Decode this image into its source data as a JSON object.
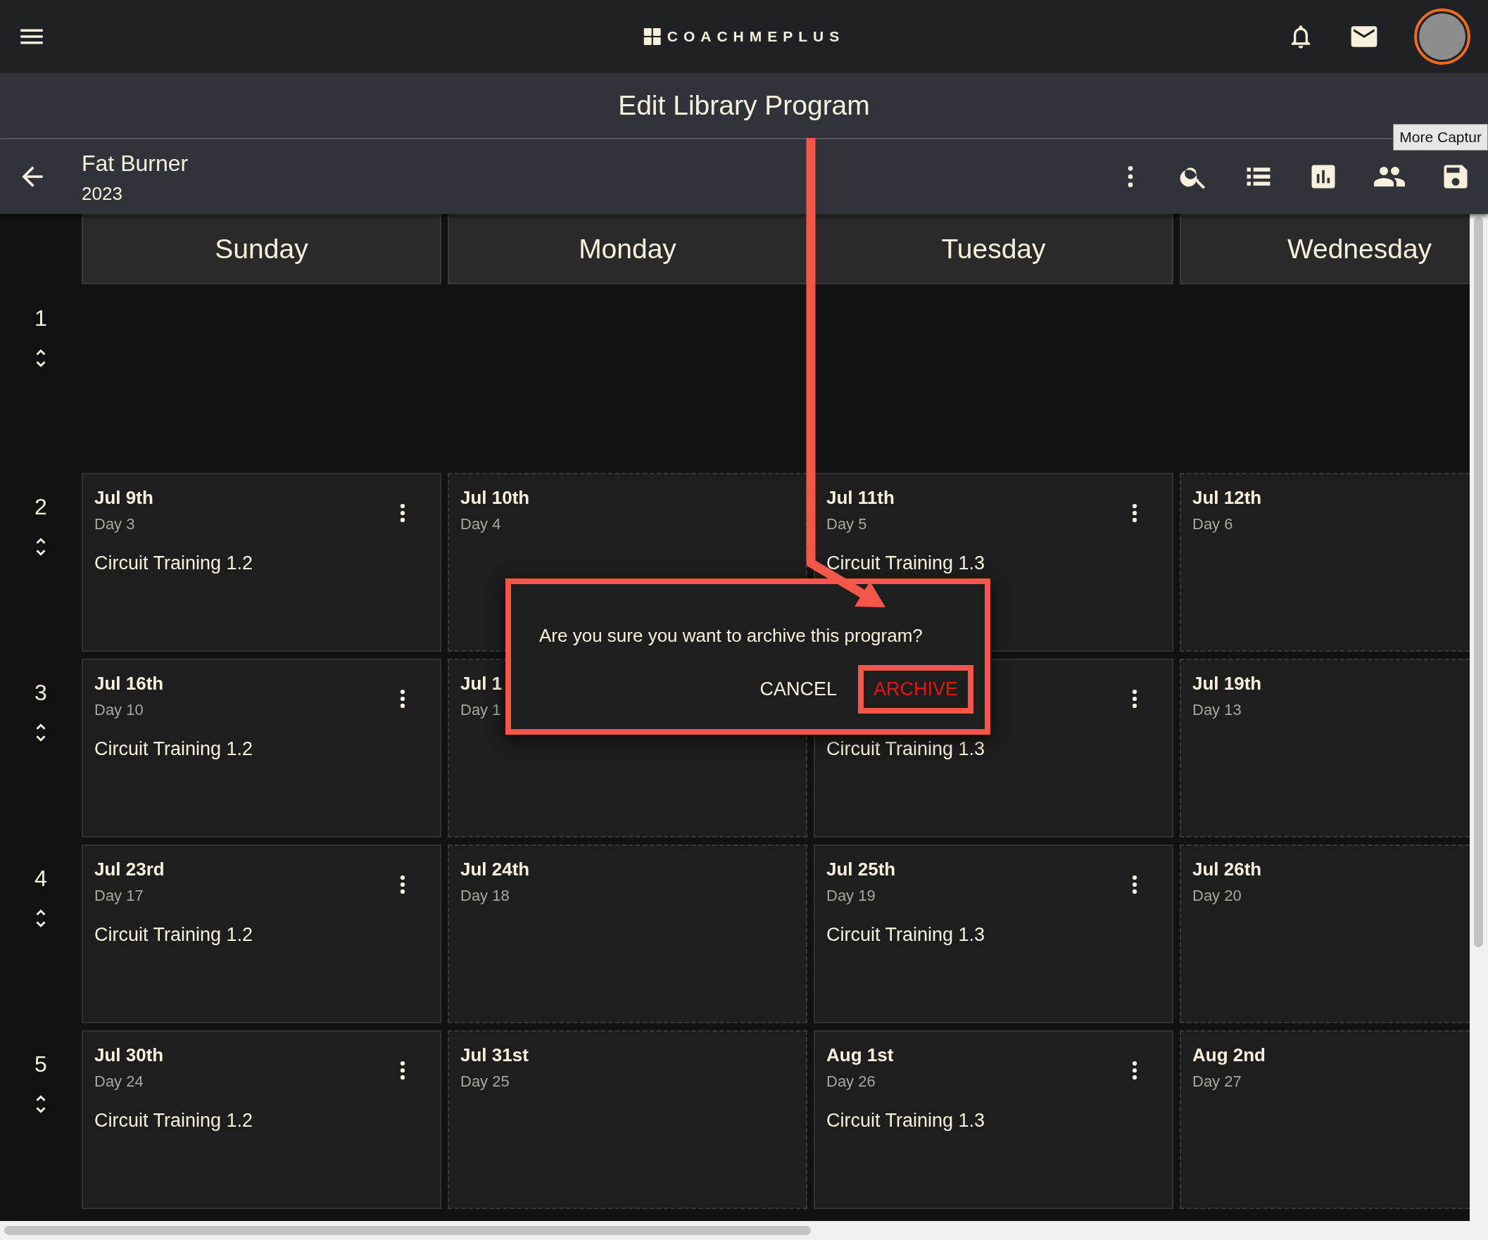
{
  "app_bar": {
    "logo_text": "COACHMEPLUS"
  },
  "page_title": "Edit Library Program",
  "program": {
    "name": "Fat Burner",
    "year": "2023"
  },
  "tooltip": "More Captur",
  "days": [
    "Sunday",
    "Monday",
    "Tuesday",
    "Wednesday"
  ],
  "weeks": [
    {
      "number": "1"
    },
    {
      "number": "2",
      "cells": [
        {
          "date": "Jul 9th",
          "day": "Day 3",
          "workout": "Circuit Training 1.2",
          "menu": true
        },
        {
          "date": "Jul 10th",
          "day": "Day 4",
          "menu": false
        },
        {
          "date": "Jul 11th",
          "day": "Day 5",
          "workout": "Circuit Training 1.3",
          "menu": true
        },
        {
          "date": "Jul 12th",
          "day": "Day 6",
          "menu": false
        }
      ]
    },
    {
      "number": "3",
      "cells": [
        {
          "date": "Jul 16th",
          "day": "Day 10",
          "workout": "Circuit Training 1.2",
          "menu": true
        },
        {
          "date": "Jul 1",
          "day": "Day 1",
          "menu": false
        },
        {
          "workout": "Circuit Training 1.3",
          "menu": true
        },
        {
          "date": "Jul 19th",
          "day": "Day 13",
          "menu": false
        }
      ]
    },
    {
      "number": "4",
      "cells": [
        {
          "date": "Jul 23rd",
          "day": "Day 17",
          "workout": "Circuit Training 1.2",
          "menu": true
        },
        {
          "date": "Jul 24th",
          "day": "Day 18",
          "menu": false
        },
        {
          "date": "Jul 25th",
          "day": "Day 19",
          "workout": "Circuit Training 1.3",
          "menu": true
        },
        {
          "date": "Jul 26th",
          "day": "Day 20",
          "menu": false
        }
      ]
    },
    {
      "number": "5",
      "cells": [
        {
          "date": "Jul 30th",
          "day": "Day 24",
          "workout": "Circuit Training 1.2",
          "menu": true
        },
        {
          "date": "Jul 31st",
          "day": "Day 25",
          "menu": false
        },
        {
          "date": "Aug 1st",
          "day": "Day 26",
          "workout": "Circuit Training 1.3",
          "menu": true
        },
        {
          "date": "Aug 2nd",
          "day": "Day 27",
          "menu": false
        }
      ]
    }
  ],
  "dialog": {
    "message": "Are you sure you want to archive this program?",
    "buttons": [
      {
        "label": "CANCEL",
        "kind": "plain"
      },
      {
        "label": "ARCHIVE",
        "kind": "danger"
      }
    ]
  }
}
